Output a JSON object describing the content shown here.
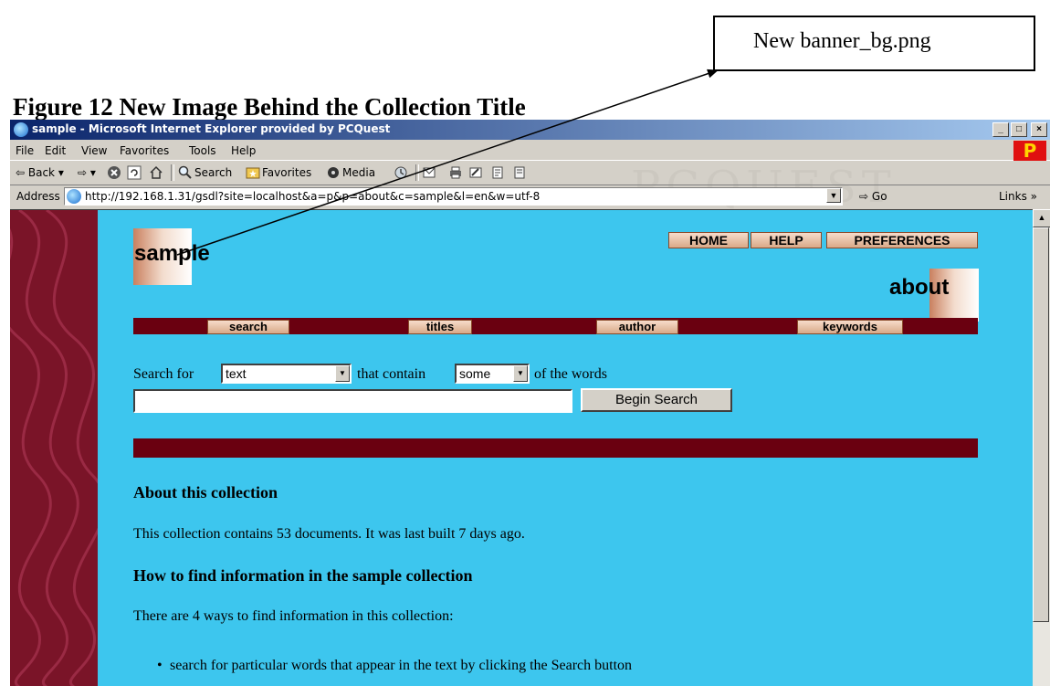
{
  "figure": {
    "caption": "Figure 12 New Image Behind the Collection Title",
    "callout_label": "New banner_bg.png"
  },
  "browser": {
    "window_title": "sample - Microsoft Internet Explorer provided by PCQuest",
    "window_buttons": {
      "minimize": "_",
      "maximize": "□",
      "close": "×"
    },
    "brand_logo": "P",
    "menu": [
      "File",
      "Edit",
      "View",
      "Favorites",
      "Tools",
      "Help"
    ],
    "toolbar": {
      "back": "⇦ Back ▾",
      "forward": "⇨ ▾",
      "search": "Search",
      "favorites": "Favorites",
      "media": "Media"
    },
    "address_label": "Address",
    "url": "http://192.168.1.31/gsdl?site=localhost&a=p&p=about&c=sample&l=en&w=utf-8",
    "go_label": "Go",
    "links_label": "Links »"
  },
  "page": {
    "collection_title": "sample",
    "top_nav": [
      "HOME",
      "HELP",
      "PREFERENCES"
    ],
    "page_title": "about",
    "nav_bar": [
      "search",
      "titles",
      "author",
      "keywords"
    ],
    "search": {
      "prefix": "Search for",
      "field_value": "text",
      "middle": "that contain",
      "mode_value": "some",
      "suffix": "of the words",
      "query_value": "",
      "button_label": "Begin Search"
    },
    "about_heading": "About this collection",
    "about_text": "This collection contains 53 documents. It was last built 7 days ago.",
    "find_heading": "How to find information in the sample collection",
    "find_text": "There are 4 ways to find information in this collection:",
    "list_items": [
      "search for particular words that appear in the text by clicking the Search button"
    ]
  },
  "colors": {
    "page_background": "#3dc6ee",
    "side_strip": "#7a1428",
    "nav_bar": "#6a0010",
    "titlebar": "#0a246a"
  }
}
